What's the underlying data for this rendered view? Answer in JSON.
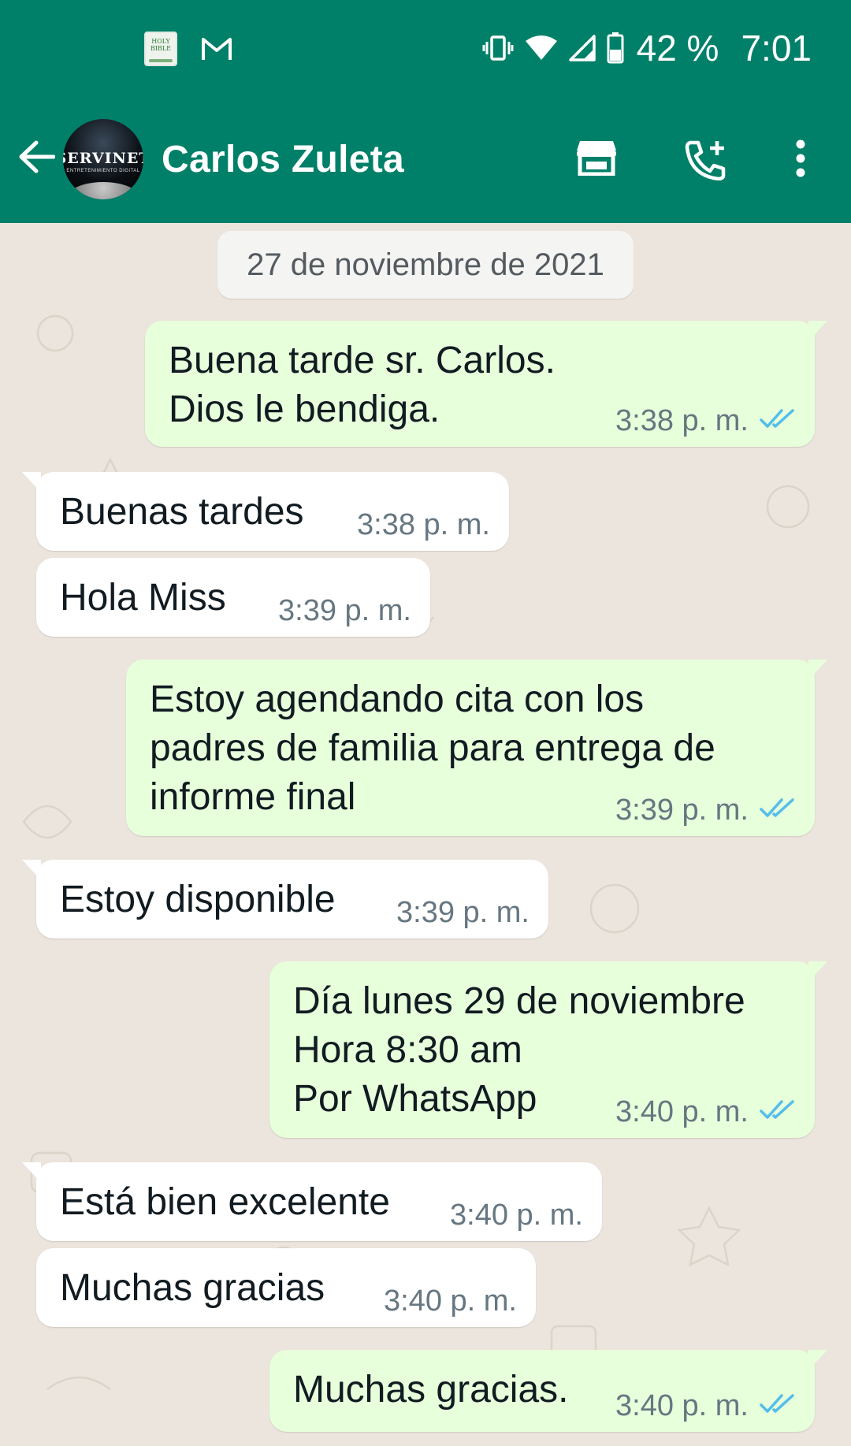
{
  "status_bar": {
    "app_icons": [
      "holy-bible-icon",
      "gmail-icon"
    ],
    "bible_icon_text": "HOLY BIBLE",
    "battery": "42 %",
    "time": "7:01"
  },
  "header": {
    "contact_name": "Carlos Zuleta",
    "avatar_brand": "SERVINET",
    "avatar_subtitle": "ENTRETENIMIENTO DIGITAL",
    "icons": [
      "back-arrow-icon",
      "shop-icon",
      "add-call-icon",
      "more-vert-icon"
    ]
  },
  "chat": {
    "date": "27 de noviembre de 2021",
    "messages": [
      {
        "direction": "out",
        "text": "Buena tarde sr. Carlos.\nDios le bendiga.",
        "time": "3:38 p. m.",
        "status": "read"
      },
      {
        "direction": "in",
        "text": "Buenas tardes",
        "time": "3:38 p. m."
      },
      {
        "direction": "in",
        "text": "Hola Miss",
        "time": "3:39 p. m."
      },
      {
        "direction": "out",
        "text": "Estoy agendando cita con los\npadres de familia para entrega de\ninforme final",
        "time": "3:39 p. m.",
        "status": "read"
      },
      {
        "direction": "in",
        "text": "Estoy disponible",
        "time": "3:39 p. m."
      },
      {
        "direction": "out",
        "text": "Día lunes 29 de noviembre\nHora 8:30 am\nPor WhatsApp",
        "time": "3:40 p. m.",
        "status": "read"
      },
      {
        "direction": "in",
        "text": "Está bien excelente",
        "time": "3:40 p. m."
      },
      {
        "direction": "in",
        "text": "Muchas gracias",
        "time": "3:40 p. m."
      },
      {
        "direction": "out",
        "text": "Muchas gracias.",
        "time": "3:40 p. m.",
        "status": "read"
      }
    ]
  },
  "colors": {
    "header": "#008069",
    "outgoing_bubble": "#E7FFDB",
    "incoming_bubble": "#FFFFFF",
    "chat_background": "#ECE5DD",
    "read_ticks": "#53BDEB"
  }
}
